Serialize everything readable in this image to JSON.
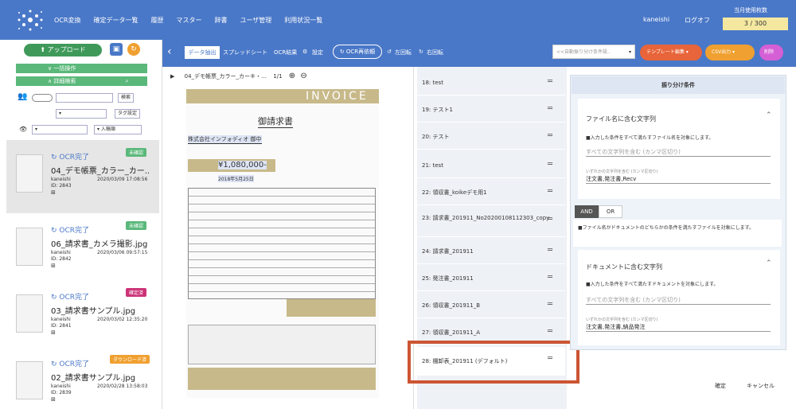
{
  "header": {
    "nav": [
      "OCR変換",
      "確定データ一覧",
      "履歴",
      "マスター",
      "辞書",
      "ユーザ管理",
      "利用状況一覧"
    ],
    "user": "kaneishi",
    "logoff": "ログオフ",
    "usage_label": "当月使用枚数",
    "usage_value": "3 / 300"
  },
  "left": {
    "upload": "アップロード",
    "bar1": "一括操作",
    "bar2": "詳細検索",
    "search_btn": "検索",
    "tag_btn": "タグ設定",
    "sort": "入稿順",
    "cards": [
      {
        "status": "OCR完了",
        "badge": "未確認",
        "badge_color": "#5ab87a",
        "name": "04_デモ帳票_カラー_カー..",
        "owner": "kaneishi",
        "date": "2020/03/09 17:08:56",
        "id": "ID: 2843"
      },
      {
        "status": "OCR完了",
        "badge": "未確認",
        "badge_color": "#5ab87a",
        "name": "06_請求書_カメラ撮影.jpg",
        "owner": "kaneishi",
        "date": "2020/03/06 09:57:15",
        "id": "ID: 2842"
      },
      {
        "status": "OCR完了",
        "badge": "確定済",
        "badge_color": "#cc3377",
        "name": "03_請求書サンプル.jpg",
        "owner": "kaneishi",
        "date": "2020/03/02 12:35:20",
        "id": "ID: 2841"
      },
      {
        "status": "OCR完了",
        "badge": "ダウンロード済",
        "badge_color": "#f0a030",
        "name": "02_請求書サンプル.jpg",
        "owner": "kaneishi",
        "date": "2020/02/28 13:58:03",
        "id": "ID: 2839"
      }
    ]
  },
  "toolbar": {
    "data_extract": "データ抽出",
    "spreadsheet": "スプレッドシート",
    "ocr_result": "OCR結果",
    "settings": "設定",
    "ocr_retry": "OCR再依頼",
    "rotate_left": "左回転",
    "rotate_right": "右回転",
    "rule_select": "<<自動振り分け条件設..",
    "template": "テンプレート編集",
    "csv": "CSV出力",
    "delete": "削除"
  },
  "viewer": {
    "filename": "04_デモ帳票_カラー_カーキ・…",
    "page": "1/1",
    "invoice_title": "INVOICE",
    "doc_title": "御請求書",
    "company": "株式会社インフォディオ 御中",
    "amount": "¥1,080,000-",
    "date": "2018年5月25日"
  },
  "list": {
    "items": [
      "18: test",
      "19: テスト1",
      "20: テスト",
      "21: test",
      "22: 領収書_koikeデモ用1",
      "23: 請求書_201911_No20200108112303_copy",
      "24: 請求書_201911",
      "25: 発注書_201911",
      "26: 領収書_201911_B",
      "27: 領収書_201911_A",
      "28: 棚卸表_201911 (デフォルト)"
    ]
  },
  "rules": {
    "header": "振り分け条件",
    "file_title": "ファイル名に含む文字列",
    "file_note": "■入力した条件をすべて満たすファイル名を対象にします。",
    "file_placeholder": "すべての文字列を含む (カンマ区切り)",
    "file_lbl": "いずれかの文字列を含む (カンマ区切り)",
    "file_val": "注文書,発注書,Recv",
    "and": "AND",
    "or": "OR",
    "andor_note": "■ファイル名かドキュメントのどちらかの条件を満たすファイルを対象にします。",
    "doc_title": "ドキュメントに含む文字列",
    "doc_note": "■入力した条件をすべて満たすドキュメントを対象にします。",
    "doc_placeholder": "すべての文字列を含む (カンマ区切り)",
    "doc_lbl": "いずれかの文字列を含む (カンマ区切り)",
    "doc_val": "注文書,発注書,納品発注",
    "confirm": "確定",
    "cancel": "キャンセル"
  }
}
